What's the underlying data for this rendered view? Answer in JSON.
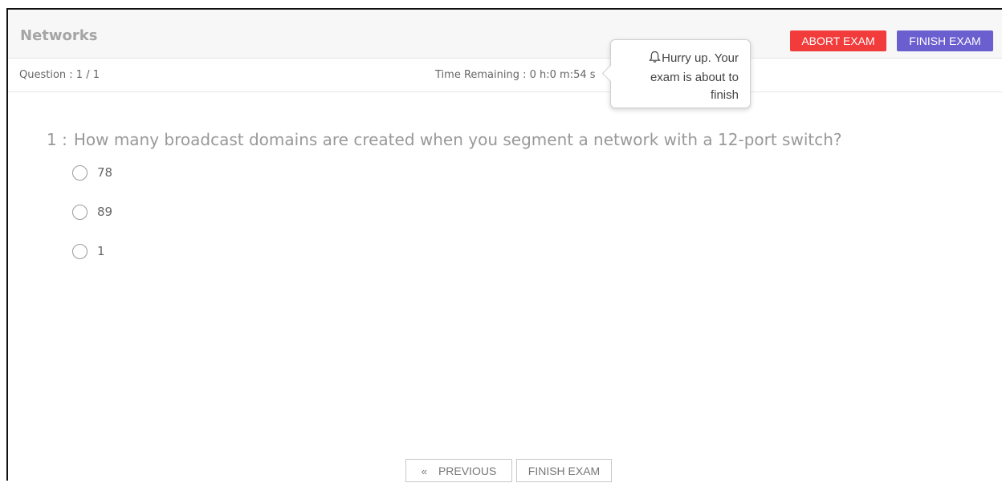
{
  "header": {
    "title": "Networks",
    "abort_label": "ABORT EXAM",
    "finish_label": "FINISH EXAM"
  },
  "status": {
    "question_count": "Question : 1 / 1",
    "time_remaining": "Time Remaining : 0 h:0 m:54 s"
  },
  "tooltip": {
    "line1": "Hurry up. Your",
    "line2": "exam is about to",
    "line3": "finish",
    "icon": "bell-icon"
  },
  "question": {
    "number": "1 :",
    "text": "How many broadcast domains are created when you segment a network with a 12-port switch?",
    "options": [
      "78",
      "89",
      "1"
    ]
  },
  "footer": {
    "previous_label": "PREVIOUS",
    "previous_icon": "«",
    "finish_label": "FINISH EXAM"
  },
  "colors": {
    "abort": "#f23b3b",
    "finish": "#6b5ecf"
  }
}
